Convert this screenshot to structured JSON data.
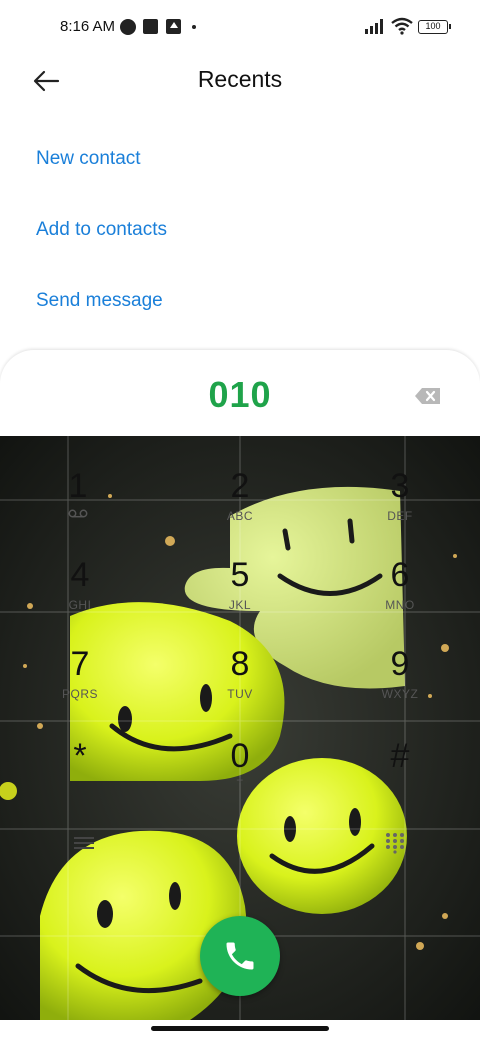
{
  "status_bar": {
    "time": "8:16 AM",
    "battery": "100",
    "icons": [
      "notification-icon",
      "app-icon",
      "upload-icon",
      "signal-icon",
      "wifi-icon",
      "battery-icon"
    ]
  },
  "header": {
    "title": "Recents",
    "back_icon": "back-arrow-icon"
  },
  "actions": [
    {
      "label": "New contact"
    },
    {
      "label": "Add to contacts"
    },
    {
      "label": "Send message"
    }
  ],
  "dialer": {
    "number": "010",
    "keys": [
      {
        "digit": "1",
        "letters": ""
      },
      {
        "digit": "2",
        "letters": "ABC"
      },
      {
        "digit": "3",
        "letters": "DEF"
      },
      {
        "digit": "4",
        "letters": "GHI"
      },
      {
        "digit": "5",
        "letters": "JKL"
      },
      {
        "digit": "6",
        "letters": "MNO"
      },
      {
        "digit": "7",
        "letters": "PQRS"
      },
      {
        "digit": "8",
        "letters": "TUV"
      },
      {
        "digit": "9",
        "letters": "WXYZ"
      },
      {
        "digit": "*",
        "letters": ""
      },
      {
        "digit": "0",
        "letters": "+"
      },
      {
        "digit": "#",
        "letters": ""
      }
    ]
  },
  "colors": {
    "accent_blue": "#1a7fd9",
    "number_green": "#1fa34a",
    "call_green": "#1fb356",
    "smiley_yellow": "#d9f21c"
  }
}
